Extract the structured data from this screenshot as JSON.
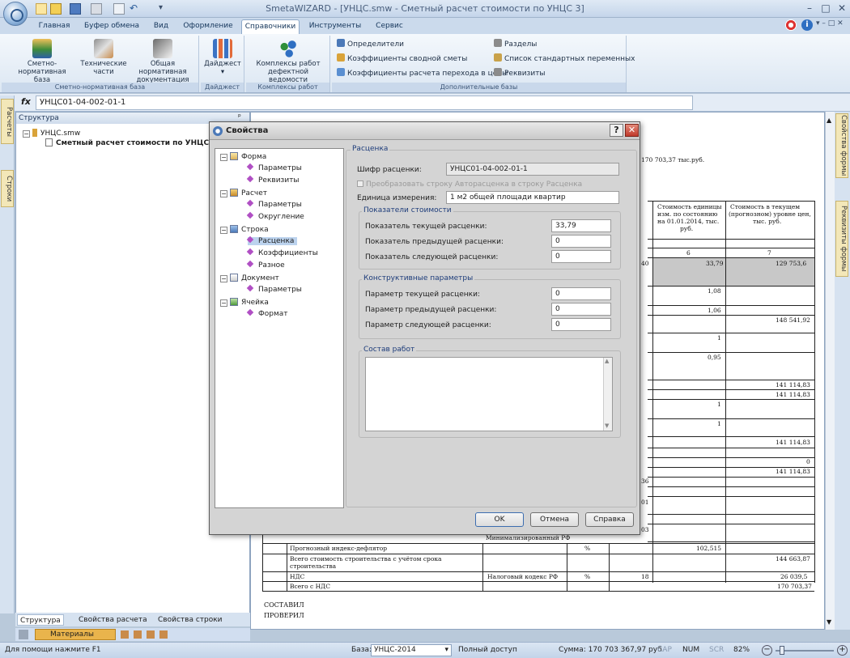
{
  "window": {
    "title": "SmetaWIZARD - [УНЦС.smw - Сметный расчет стоимости по УНЦС 3]"
  },
  "tabs": [
    "Главная",
    "Буфер обмена",
    "Вид",
    "Оформление",
    "Справочники",
    "Инструменты",
    "Сервис"
  ],
  "active_tab": "Справочники",
  "ribbon": {
    "groups": [
      {
        "label": "Сметно-нормативная база",
        "buttons": [
          "Сметно-нормативная база",
          "Технические части",
          "Общая нормативная документация"
        ]
      },
      {
        "label": "Дайджест",
        "buttons": [
          "Дайджест"
        ]
      },
      {
        "label": "Комплексы работ",
        "buttons": [
          "Комплексы работ дефектной ведомости"
        ]
      },
      {
        "label": "Дополнительные базы",
        "col1": [
          "Определители",
          "Коэффициенты сводной сметы",
          "Коэффициенты расчета перехода в цены"
        ],
        "col2": [
          "Разделы",
          "Список стандартных переменных",
          "Реквизиты"
        ]
      }
    ],
    "labels": {
      "snb_1": "Сметно-нормативная",
      "snb_2": "база",
      "tech_1": "Технические",
      "tech_2": "части",
      "ond_1": "Общая нормативная",
      "ond_2": "документация",
      "digest": "Дайджест",
      "kr_1": "Комплексы работ",
      "kr_2": "дефектной ведомости"
    }
  },
  "formula": {
    "fx": "fx",
    "value": "УНЦС01-04-002-01-1"
  },
  "left_strip": [
    "Расчеты",
    "Строки"
  ],
  "right_strip": [
    "Свойства формы",
    "Реквизиты формы"
  ],
  "structure": {
    "header": "Структура",
    "root": "УНЦС.smw",
    "child": "Сметный расчет стоимости по УНЦС 3"
  },
  "panel_tabs": [
    "Структура",
    "Свойства расчета",
    "Свойства строки"
  ],
  "materials_label": "Материалы",
  "dialog": {
    "title": "Свойства",
    "help": "?",
    "close": "✕",
    "tree": [
      {
        "label": "Форма",
        "children": [
          "Параметры",
          "Реквизиты"
        ]
      },
      {
        "label": "Расчет",
        "children": [
          "Параметры",
          "Округление"
        ]
      },
      {
        "label": "Строка",
        "children": [
          "Расценка",
          "Коэффициенты",
          "Разное"
        ]
      },
      {
        "label": "Документ",
        "children": [
          "Параметры"
        ]
      },
      {
        "label": "Ячейка",
        "children": [
          "Формат"
        ]
      }
    ],
    "selected_node": "Расценка",
    "section_title": "Расценка",
    "cipher_label": "Шифр расценки:",
    "cipher_value": "УНЦС01-04-002-01-1",
    "convert_checkbox": "Преобразовать строку Авторасценка в строку Расценка",
    "unit_label": "Единица измерения:",
    "unit_value": "1 м2 общей площади квартир",
    "cost_group": "Показатели стоимости",
    "cost_current_label": "Показатель текущей расценки:",
    "cost_current_value": "33,79",
    "cost_prev_label": "Показатель предыдущей расценки:",
    "cost_prev_value": "0",
    "cost_next_label": "Показатель следующей расценки:",
    "cost_next_value": "0",
    "constr_group": "Конструктивные параметры",
    "param_current_label": "Параметр текущей расценки:",
    "param_current_value": "0",
    "param_prev_label": "Параметр предыдущей расценки:",
    "param_prev_value": "0",
    "param_next_label": "Параметр следующей расценки:",
    "param_next_value": "0",
    "works_group": "Состав работ",
    "ok": "OK",
    "cancel": "Отмена",
    "help_btn": "Справка"
  },
  "document": {
    "total_header": "170 703,37 тыс.руб.",
    "col6_header_1": "Стоимость единицы",
    "col6_header_2": "изм. по состоянию",
    "col6_header_3": "на 01.01.2014, тыс.",
    "col6_header_4": "руб.",
    "col7_header_1": "Стоимость в текущем",
    "col7_header_2": "(прогнозном) уровне цен,",
    "col7_header_3": "тыс. руб.",
    "col6_num": "6",
    "col7_num": "7",
    "clip_40": "40",
    "clip_36": "36",
    "clip_01": "01",
    "clip_03": "03",
    "v6": [
      "33,79",
      "1,08",
      "1,06",
      "1",
      "0,95",
      "1",
      "1"
    ],
    "v7": [
      "129 753,6",
      "148 541,92",
      "141 114,83",
      "141 114,83",
      "141 114,83",
      "0",
      "141 114,83"
    ],
    "b_deflator": "Прогнозный индекс-дефлятор",
    "b_deflator_unit": "%",
    "b_deflator_val": "102,515",
    "b_total_1": "Всего стоимость строительства с учётом срока",
    "b_total_2": "строительства",
    "b_total_val": "144 663,87",
    "b_vat": "НДС",
    "b_vat_src": "Налоговый кодекс РФ",
    "b_vat_unit": "%",
    "b_vat_rate": "18",
    "b_vat_val": "26 039,5",
    "b_grand": "Всего с НДС",
    "b_grand_val": "170 703,37",
    "b_clip": "Минимализированный РФ",
    "composed": "СОСТАВИЛ",
    "checked": "ПРОВЕРИЛ"
  },
  "status": {
    "help": "Для помощи нажмите F1",
    "base_label": "База:",
    "base_value": "УНЦС-2014",
    "access": "Полный доступ",
    "sum": "Сумма: 170 703 367,97 руб.",
    "cap": "CAP",
    "num": "NUM",
    "scr": "SCR",
    "zoom": "82%"
  },
  "colors": {
    "accent": "#d8e4f2",
    "dialog": "#d4d4d4",
    "selected": "#bcd3ee"
  }
}
